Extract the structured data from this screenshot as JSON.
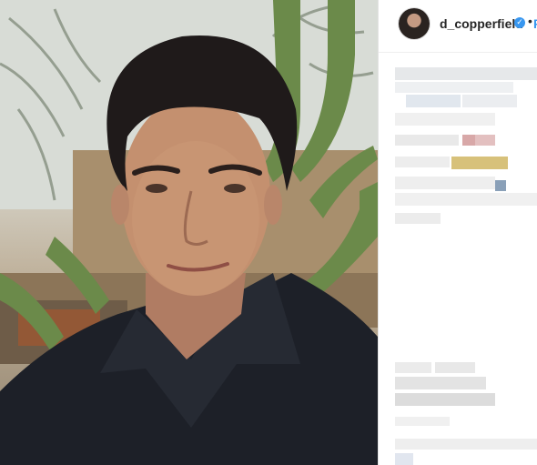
{
  "post": {
    "author": {
      "username": "d_copperfield",
      "verified": true,
      "verified_icon": "verified-badge-icon",
      "separator": "•",
      "follow_label": "Follow"
    },
    "media": {
      "type": "video-frame",
      "subject": "man in black shirt in front of cactus tree"
    },
    "comments_visible": false
  },
  "colors": {
    "accent": "#3897f0",
    "text": "#262626",
    "border": "#efefef"
  }
}
